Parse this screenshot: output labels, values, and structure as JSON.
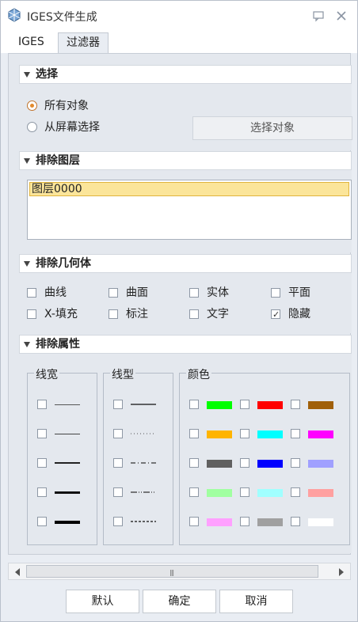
{
  "window": {
    "title": "IGES文件生成"
  },
  "tabs": [
    {
      "label": "IGES",
      "active": false
    },
    {
      "label": "过滤器",
      "active": true
    }
  ],
  "selection": {
    "header": "选择",
    "options": [
      {
        "label": "所有对象",
        "checked": true
      },
      {
        "label": "从屏幕选择",
        "checked": false
      }
    ],
    "select_button": "选择对象"
  },
  "exclude_layers": {
    "header": "排除图层",
    "items": [
      "图层0000"
    ]
  },
  "exclude_geometry": {
    "header": "排除几何体",
    "items": [
      {
        "label": "曲线",
        "checked": false
      },
      {
        "label": "曲面",
        "checked": false
      },
      {
        "label": "实体",
        "checked": false
      },
      {
        "label": "平面",
        "checked": false
      },
      {
        "label": "X-填充",
        "checked": false
      },
      {
        "label": "标注",
        "checked": false
      },
      {
        "label": "文字",
        "checked": false
      },
      {
        "label": "隐藏",
        "checked": true
      }
    ]
  },
  "exclude_attributes": {
    "header": "排除属性",
    "line_width": {
      "title": "线宽"
    },
    "line_type": {
      "title": "线型"
    },
    "color": {
      "title": "颜色",
      "swatches": [
        "#00ff00",
        "#ff0000",
        "#a0600a",
        "#ffb400",
        "#00ffff",
        "#ff00ff",
        "#606060",
        "#0000ff",
        "#a0a0ff",
        "#a0ffa0",
        "#a0ffff",
        "#ffa0a0",
        "#ffa0ff",
        "#a0a0a0",
        "#ffffff"
      ]
    }
  },
  "buttons": {
    "default": "默认",
    "ok": "确定",
    "cancel": "取消"
  },
  "colors": {
    "accent_radio": "#e38a2c",
    "layer_highlight": "#fbe59a"
  }
}
